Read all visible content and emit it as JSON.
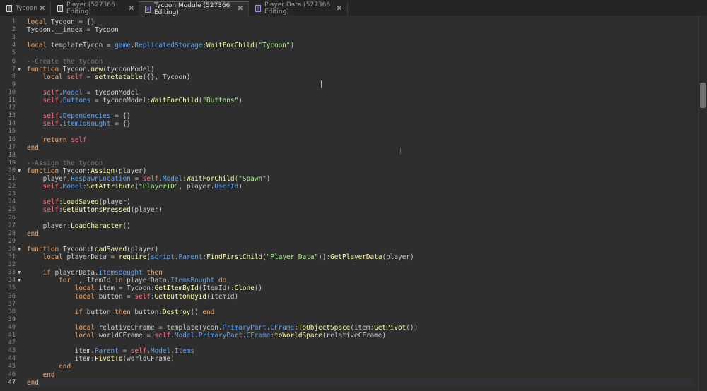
{
  "tabs": [
    {
      "label": "Tycoon",
      "icon": "script-icon",
      "close": "✕",
      "active": false
    },
    {
      "label": "Player (527366 Editing)",
      "icon": "module-script-icon",
      "close": "✕",
      "active": false
    },
    {
      "label": "Tycoon Module (527366 Editing)",
      "icon": "module-script-purple-icon",
      "close": "✕",
      "active": true
    },
    {
      "label": "Player Data (527366 Editing)",
      "icon": "module-script-purple-icon",
      "close": "✕",
      "active": false
    }
  ],
  "colors": {
    "keyword": "#f2a76c",
    "comment": "#6b7d6b",
    "string": "#adf195",
    "property": "#61a1f1",
    "function": "#fdfbac",
    "self": "#f86d7c",
    "text": "#cccccc",
    "background": "#2e2e2e"
  },
  "editor": {
    "current_line": 47,
    "folds": [
      7,
      20,
      30,
      33,
      34
    ],
    "lines": [
      [
        [
          "kw",
          "local"
        ],
        [
          "t",
          " Tycoon = {}"
        ]
      ],
      [
        [
          "t",
          "Tycoon.__index = Tycoon"
        ]
      ],
      [],
      [
        [
          "kw",
          "local"
        ],
        [
          "t",
          " templateTycon = "
        ],
        [
          "prop",
          "game"
        ],
        [
          "t",
          "."
        ],
        [
          "prop",
          "ReplicatedStorage"
        ],
        [
          "t",
          ":"
        ],
        [
          "fn",
          "WaitForChild"
        ],
        [
          "t",
          "("
        ],
        [
          "str",
          "\"Tycoon\""
        ],
        [
          "t",
          ")"
        ]
      ],
      [],
      [
        [
          "cm",
          "--Create the tycoon"
        ]
      ],
      [
        [
          "kw",
          "function"
        ],
        [
          "t",
          " Tycoon."
        ],
        [
          "fn",
          "new"
        ],
        [
          "t",
          "(tycoonModel)"
        ]
      ],
      [
        [
          "t",
          "    "
        ],
        [
          "kw",
          "local"
        ],
        [
          "t",
          " "
        ],
        [
          "self",
          "self"
        ],
        [
          "t",
          " = "
        ],
        [
          "fn",
          "setmetatable"
        ],
        [
          "t",
          "({}, Tycoon)"
        ]
      ],
      [],
      [
        [
          "t",
          "    "
        ],
        [
          "self",
          "self"
        ],
        [
          "t",
          "."
        ],
        [
          "prop",
          "Model"
        ],
        [
          "t",
          " = tycoonModel"
        ]
      ],
      [
        [
          "t",
          "    "
        ],
        [
          "self",
          "self"
        ],
        [
          "t",
          "."
        ],
        [
          "prop",
          "Buttons"
        ],
        [
          "t",
          " = tycoonModel:"
        ],
        [
          "fn",
          "WaitForChild"
        ],
        [
          "t",
          "("
        ],
        [
          "str",
          "\"Buttons\""
        ],
        [
          "t",
          ")"
        ]
      ],
      [],
      [
        [
          "t",
          "    "
        ],
        [
          "self",
          "self"
        ],
        [
          "t",
          "."
        ],
        [
          "prop",
          "Dependencies"
        ],
        [
          "t",
          " = {}"
        ]
      ],
      [
        [
          "t",
          "    "
        ],
        [
          "self",
          "self"
        ],
        [
          "t",
          "."
        ],
        [
          "prop",
          "ItemIdBought"
        ],
        [
          "t",
          " = {}"
        ]
      ],
      [],
      [
        [
          "t",
          "    "
        ],
        [
          "kw",
          "return"
        ],
        [
          "t",
          " "
        ],
        [
          "self",
          "self"
        ]
      ],
      [
        [
          "kw",
          "end"
        ]
      ],
      [],
      [
        [
          "cm",
          "--Assign the tycoon"
        ]
      ],
      [
        [
          "kw",
          "function"
        ],
        [
          "t",
          " Tycoon:"
        ],
        [
          "fn",
          "Assign"
        ],
        [
          "t",
          "(player)"
        ]
      ],
      [
        [
          "t",
          "    player."
        ],
        [
          "prop",
          "RespawnLocation"
        ],
        [
          "t",
          " = "
        ],
        [
          "self",
          "self"
        ],
        [
          "t",
          "."
        ],
        [
          "prop",
          "Model"
        ],
        [
          "t",
          ":"
        ],
        [
          "fn",
          "WaitForChild"
        ],
        [
          "t",
          "("
        ],
        [
          "str",
          "\"Spawn\""
        ],
        [
          "t",
          ")"
        ]
      ],
      [
        [
          "t",
          "    "
        ],
        [
          "self",
          "self"
        ],
        [
          "t",
          "."
        ],
        [
          "prop",
          "Model"
        ],
        [
          "t",
          ":"
        ],
        [
          "fn",
          "SetAttribute"
        ],
        [
          "t",
          "("
        ],
        [
          "str",
          "\"PlayerID\""
        ],
        [
          "t",
          ", player."
        ],
        [
          "prop",
          "UserId"
        ],
        [
          "t",
          ")"
        ]
      ],
      [],
      [
        [
          "t",
          "    "
        ],
        [
          "self",
          "self"
        ],
        [
          "t",
          ":"
        ],
        [
          "fn",
          "LoadSaved"
        ],
        [
          "t",
          "(player)"
        ]
      ],
      [
        [
          "t",
          "    "
        ],
        [
          "self",
          "self"
        ],
        [
          "t",
          ":"
        ],
        [
          "fn",
          "GetButtonsPressed"
        ],
        [
          "t",
          "(player)"
        ]
      ],
      [],
      [
        [
          "t",
          "    player:"
        ],
        [
          "fn",
          "LoadCharacter"
        ],
        [
          "t",
          "()"
        ]
      ],
      [
        [
          "kw",
          "end"
        ]
      ],
      [],
      [
        [
          "kw",
          "function"
        ],
        [
          "t",
          " Tycoon:"
        ],
        [
          "fn",
          "LoadSaved"
        ],
        [
          "t",
          "(player)"
        ]
      ],
      [
        [
          "t",
          "    "
        ],
        [
          "kw",
          "local"
        ],
        [
          "t",
          " playerData = "
        ],
        [
          "fn",
          "require"
        ],
        [
          "t",
          "("
        ],
        [
          "prop",
          "script"
        ],
        [
          "t",
          "."
        ],
        [
          "prop",
          "Parent"
        ],
        [
          "t",
          ":"
        ],
        [
          "fn",
          "FindFirstChild"
        ],
        [
          "t",
          "("
        ],
        [
          "str",
          "\"Player Data\""
        ],
        [
          "t",
          "))"
        ],
        [
          "t",
          ":"
        ],
        [
          "fn",
          "GetPlayerData"
        ],
        [
          "t",
          "(player)"
        ]
      ],
      [],
      [
        [
          "t",
          "    "
        ],
        [
          "kw",
          "if"
        ],
        [
          "t",
          " playerData."
        ],
        [
          "prop",
          "ItemsBought"
        ],
        [
          "t",
          " "
        ],
        [
          "kw",
          "then"
        ]
      ],
      [
        [
          "t",
          "        "
        ],
        [
          "kw",
          "for"
        ],
        [
          "t",
          " _, ItemId "
        ],
        [
          "kw",
          "in"
        ],
        [
          "t",
          " playerData."
        ],
        [
          "prop",
          "ItemsBought"
        ],
        [
          "t",
          " "
        ],
        [
          "kw",
          "do"
        ]
      ],
      [
        [
          "t",
          "            "
        ],
        [
          "kw",
          "local"
        ],
        [
          "t",
          " item = Tycoon:"
        ],
        [
          "fn",
          "GetItemById"
        ],
        [
          "t",
          "(ItemId):"
        ],
        [
          "fn",
          "Clone"
        ],
        [
          "t",
          "()"
        ]
      ],
      [
        [
          "t",
          "            "
        ],
        [
          "kw",
          "local"
        ],
        [
          "t",
          " button = "
        ],
        [
          "self",
          "self"
        ],
        [
          "t",
          ":"
        ],
        [
          "fn",
          "GetButtonById"
        ],
        [
          "t",
          "(ItemId)"
        ]
      ],
      [],
      [
        [
          "t",
          "            "
        ],
        [
          "kw",
          "if"
        ],
        [
          "t",
          " button "
        ],
        [
          "kw",
          "then"
        ],
        [
          "t",
          " button:"
        ],
        [
          "fn",
          "Destroy"
        ],
        [
          "t",
          "() "
        ],
        [
          "kw",
          "end"
        ]
      ],
      [],
      [
        [
          "t",
          "            "
        ],
        [
          "kw",
          "local"
        ],
        [
          "t",
          " relativeCFrame = templateTycon."
        ],
        [
          "prop",
          "PrimaryPart"
        ],
        [
          "t",
          "."
        ],
        [
          "prop",
          "CFrame"
        ],
        [
          "t",
          ":"
        ],
        [
          "fn",
          "ToObjectSpace"
        ],
        [
          "t",
          "(item:"
        ],
        [
          "fn",
          "GetPivot"
        ],
        [
          "t",
          "())"
        ]
      ],
      [
        [
          "t",
          "            "
        ],
        [
          "kw",
          "local"
        ],
        [
          "t",
          " worldCFrame = "
        ],
        [
          "self",
          "self"
        ],
        [
          "t",
          "."
        ],
        [
          "prop",
          "Model"
        ],
        [
          "t",
          "."
        ],
        [
          "prop",
          "PrimaryPart"
        ],
        [
          "t",
          "."
        ],
        [
          "prop",
          "CFrame"
        ],
        [
          "t",
          ":"
        ],
        [
          "fn",
          "toWorldSpace"
        ],
        [
          "t",
          "(relativeCFrame)"
        ]
      ],
      [],
      [
        [
          "t",
          "            item."
        ],
        [
          "prop",
          "Parent"
        ],
        [
          "t",
          " = "
        ],
        [
          "self",
          "self"
        ],
        [
          "t",
          "."
        ],
        [
          "prop",
          "Model"
        ],
        [
          "t",
          "."
        ],
        [
          "prop",
          "Items"
        ]
      ],
      [
        [
          "t",
          "            item:"
        ],
        [
          "fn",
          "PivotTo"
        ],
        [
          "t",
          "(worldCFrame)"
        ]
      ],
      [
        [
          "t",
          "        "
        ],
        [
          "kw",
          "end"
        ]
      ],
      [
        [
          "t",
          "    "
        ],
        [
          "kw",
          "end"
        ]
      ],
      [
        [
          "kw",
          "end"
        ]
      ]
    ]
  }
}
